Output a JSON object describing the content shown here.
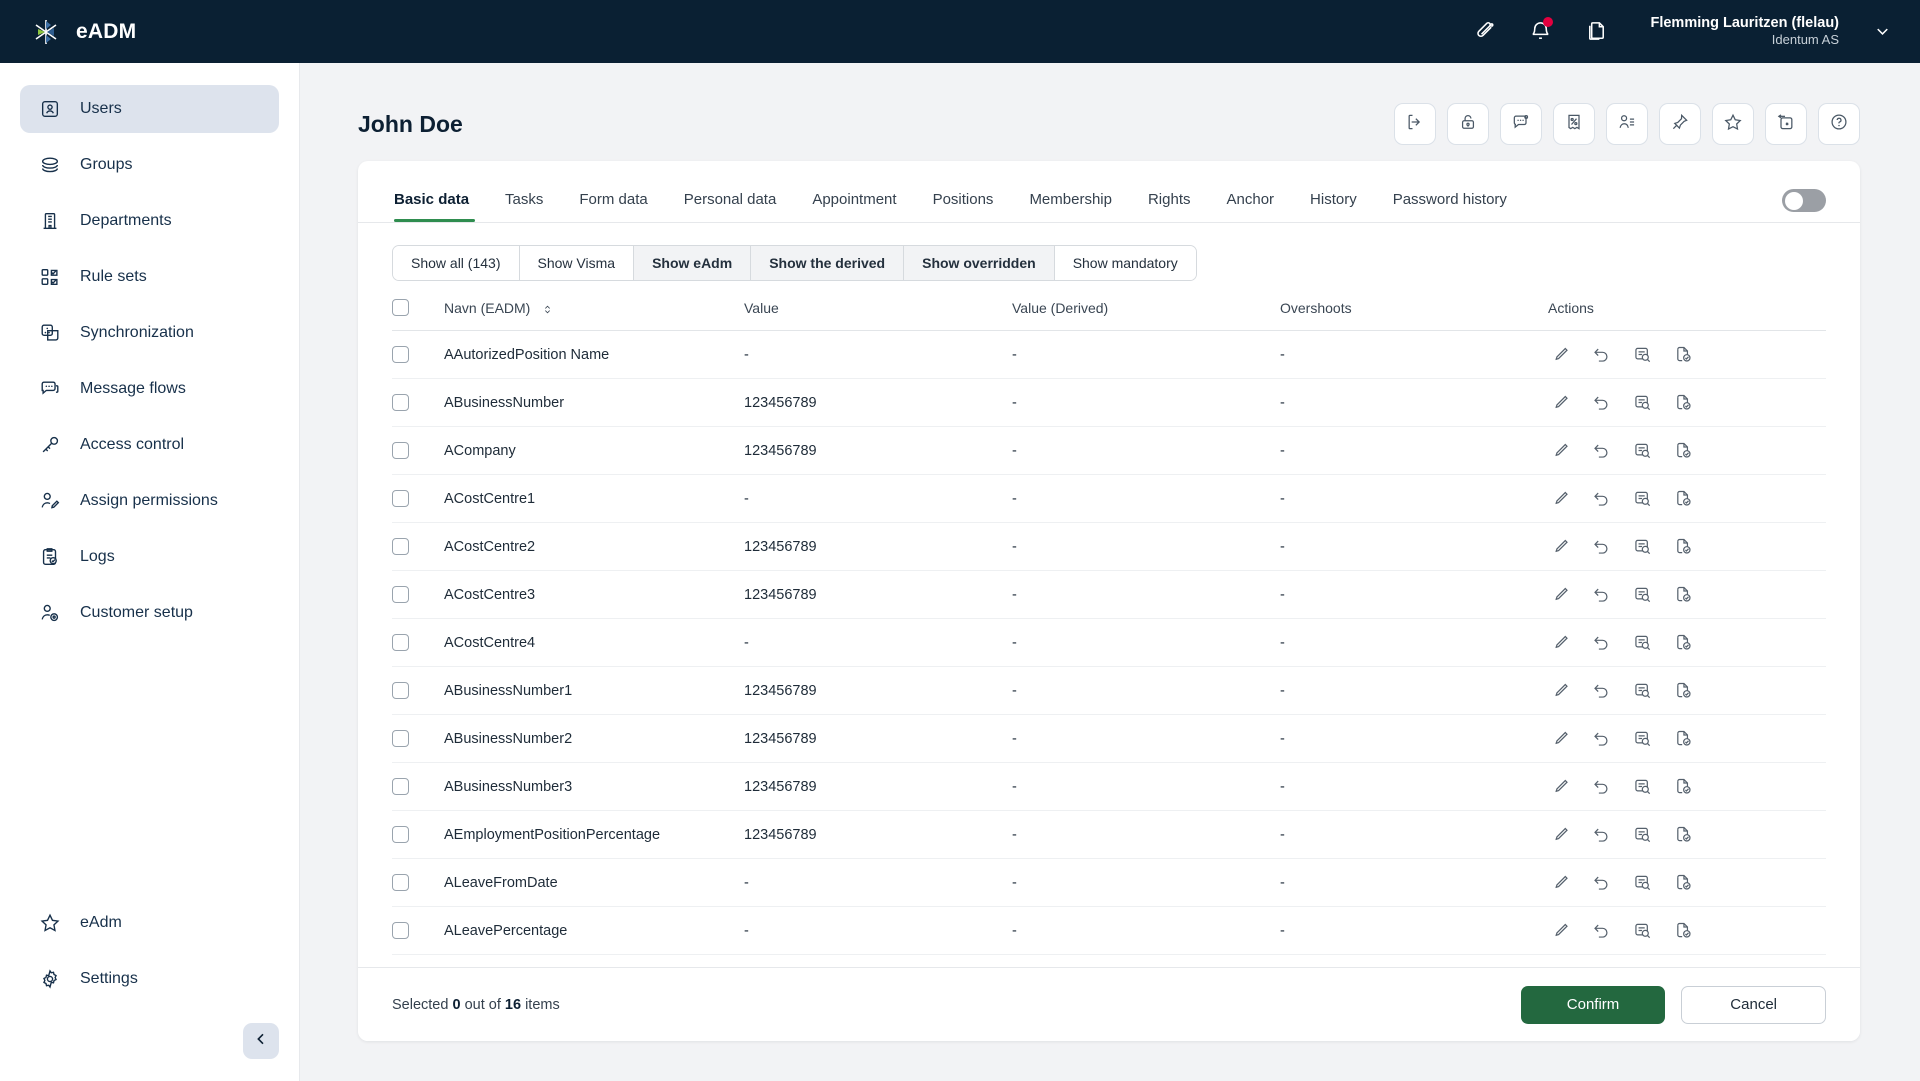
{
  "app": {
    "brand_name": "eADM",
    "brand_logo_icon": "snowflake-logo-icon"
  },
  "topbar": {
    "icons": [
      {
        "name": "paperclip-icon",
        "label": "Attachments"
      },
      {
        "name": "bell-icon",
        "label": "Notifications",
        "badge": true
      },
      {
        "name": "copy-documents-icon",
        "label": "Documents"
      }
    ],
    "user": {
      "name": "Flemming Lauritzen (flelau)",
      "organization": "Identum AS",
      "caret_icon": "chevron-down-icon"
    }
  },
  "sidebar": {
    "items": [
      {
        "label": "Users",
        "icon": "contact-card-icon",
        "active": true
      },
      {
        "label": "Groups",
        "icon": "layers-icon",
        "active": false
      },
      {
        "label": "Departments",
        "icon": "building-icon",
        "active": false
      },
      {
        "label": "Rule sets",
        "icon": "checklist-squares-icon",
        "active": false
      },
      {
        "label": "Synchronization",
        "icon": "sync-nodes-icon",
        "active": false
      },
      {
        "label": "Message flows",
        "icon": "chat-bubbles-icon",
        "active": false
      },
      {
        "label": "Access control",
        "icon": "key-icon",
        "active": false
      },
      {
        "label": "Assign permissions",
        "icon": "user-edit-icon",
        "active": false
      },
      {
        "label": "Logs",
        "icon": "clipboard-check-icon",
        "active": false
      },
      {
        "label": "Customer setup",
        "icon": "user-gear-icon",
        "active": false
      }
    ],
    "bottom_items": [
      {
        "label": "eAdm",
        "icon": "star-icon"
      },
      {
        "label": "Settings",
        "icon": "gear-icon"
      }
    ],
    "collapse_icon": "chevron-left-icon"
  },
  "page": {
    "title": "John Doe",
    "toolbar_buttons": [
      {
        "name": "logout-arrow-icon",
        "label": "Log out"
      },
      {
        "name": "lock-icon",
        "label": "Lock"
      },
      {
        "name": "comment-icon",
        "label": "Comment"
      },
      {
        "name": "percent-ticket-icon",
        "label": "Percentage"
      },
      {
        "name": "user-details-icon",
        "label": "User details"
      },
      {
        "name": "pin-icon",
        "label": "Pin"
      },
      {
        "name": "star-icon",
        "label": "Favorite"
      },
      {
        "name": "undo-box-icon",
        "label": "Undo delete"
      },
      {
        "name": "help-circle-icon",
        "label": "Help"
      }
    ]
  },
  "tabs": [
    {
      "label": "Basic data",
      "active": true
    },
    {
      "label": "Tasks",
      "active": false
    },
    {
      "label": "Form data",
      "active": false
    },
    {
      "label": "Personal data",
      "active": false
    },
    {
      "label": "Appointment",
      "active": false
    },
    {
      "label": "Positions",
      "active": false
    },
    {
      "label": "Membership",
      "active": false
    },
    {
      "label": "Rights",
      "active": false
    },
    {
      "label": "Anchor",
      "active": false
    },
    {
      "label": "History",
      "active": false
    },
    {
      "label": "Password history",
      "active": false
    }
  ],
  "view_toggle": {
    "on": false,
    "name": "view-mode-toggle"
  },
  "filters": [
    {
      "label": "Show all (143)",
      "active": false
    },
    {
      "label": "Show Visma",
      "active": false
    },
    {
      "label": "Show eAdm",
      "active": true
    },
    {
      "label": "Show the derived",
      "active": true
    },
    {
      "label": "Show overridden",
      "active": true
    },
    {
      "label": "Show mandatory",
      "active": false
    }
  ],
  "table": {
    "columns": [
      {
        "key": "check",
        "label": ""
      },
      {
        "key": "name",
        "label": "Navn (EADM)",
        "sortable": true,
        "sort_icon": "sort-updown-icon"
      },
      {
        "key": "value",
        "label": "Value"
      },
      {
        "key": "derived",
        "label": "Value (Derived)"
      },
      {
        "key": "overshoots",
        "label": "Overshoots"
      },
      {
        "key": "actions",
        "label": "Actions"
      }
    ],
    "row_action_icons": [
      {
        "name": "pencil-edit-icon",
        "label": "Edit"
      },
      {
        "name": "undo-revert-icon",
        "label": "Revert"
      },
      {
        "name": "document-search-icon",
        "label": "Inspect"
      },
      {
        "name": "document-check-icon",
        "label": "Approve"
      }
    ],
    "rows": [
      {
        "selected": false,
        "name": "AAutorizedPosition Name",
        "value": "-",
        "derived": "-",
        "overshoots": "-"
      },
      {
        "selected": false,
        "name": "ABusinessNumber",
        "value": "123456789",
        "derived": "-",
        "overshoots": "-"
      },
      {
        "selected": false,
        "name": "ACompany",
        "value": "123456789",
        "derived": "-",
        "overshoots": "-"
      },
      {
        "selected": false,
        "name": "ACostCentre1",
        "value": "-",
        "derived": "-",
        "overshoots": "-"
      },
      {
        "selected": false,
        "name": "ACostCentre2",
        "value": "123456789",
        "derived": "-",
        "overshoots": "-"
      },
      {
        "selected": false,
        "name": "ACostCentre3",
        "value": "123456789",
        "derived": "-",
        "overshoots": "-"
      },
      {
        "selected": false,
        "name": "ACostCentre4",
        "value": "-",
        "derived": "-",
        "overshoots": "-"
      },
      {
        "selected": false,
        "name": "ABusinessNumber1",
        "value": "123456789",
        "derived": "-",
        "overshoots": "-"
      },
      {
        "selected": false,
        "name": "ABusinessNumber2",
        "value": "123456789",
        "derived": "-",
        "overshoots": "-"
      },
      {
        "selected": false,
        "name": "ABusinessNumber3",
        "value": "123456789",
        "derived": "-",
        "overshoots": "-"
      },
      {
        "selected": false,
        "name": "AEmploymentPositionPercentage",
        "value": "123456789",
        "derived": "-",
        "overshoots": "-"
      },
      {
        "selected": false,
        "name": "ALeaveFromDate",
        "value": "-",
        "derived": "-",
        "overshoots": "-"
      },
      {
        "selected": false,
        "name": "ALeavePercentage",
        "value": "-",
        "derived": "-",
        "overshoots": "-"
      }
    ]
  },
  "footer": {
    "selection_prefix": "Selected",
    "selected_count": "0",
    "selection_middle": "out of",
    "total_count": "16",
    "selection_suffix": "items",
    "confirm_label": "Confirm",
    "cancel_label": "Cancel"
  },
  "colors": {
    "topbar_bg": "#0a2033",
    "accent_green": "#2f8d4f",
    "confirm_green": "#23683f",
    "notification_red": "#e3003f",
    "sidebar_active": "#dde3ed"
  }
}
